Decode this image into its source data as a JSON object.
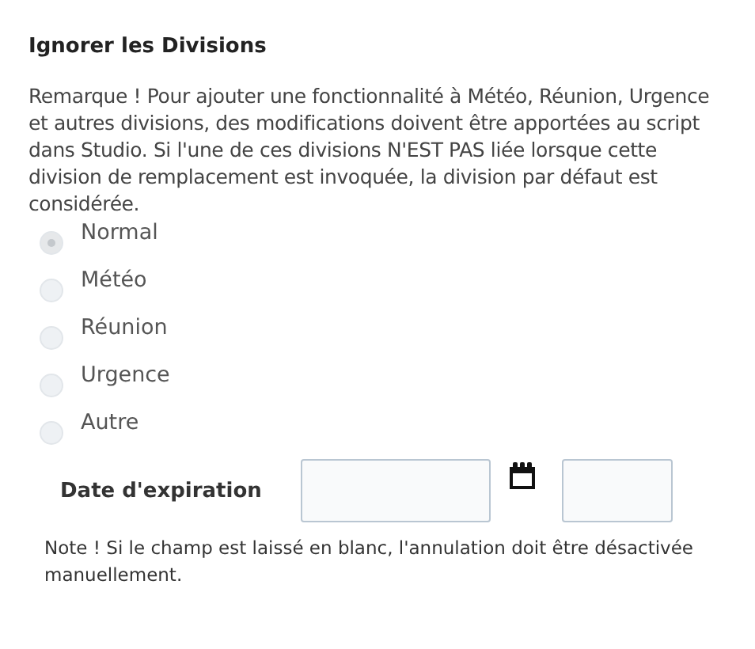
{
  "title": "Ignorer les Divisions",
  "remark": "Remarque ! Pour ajouter une fonctionnalité à Météo, Réunion, Urgence et autres divisions, des modifications doivent être apportées au script dans Studio. Si l'une de ces divisions N'EST PAS liée lorsque cette division de remplacement est invoquée, la division par défaut est considérée.",
  "options": [
    {
      "label": "Normal",
      "selected": true
    },
    {
      "label": "Météo",
      "selected": false
    },
    {
      "label": "Réunion",
      "selected": false
    },
    {
      "label": "Urgence",
      "selected": false
    },
    {
      "label": "Autre",
      "selected": false
    }
  ],
  "expiration": {
    "label": "Date d'expiration"
  },
  "note": "Note ! Si le champ est laissé en blanc, l'annulation doit être désactivée manuellement."
}
